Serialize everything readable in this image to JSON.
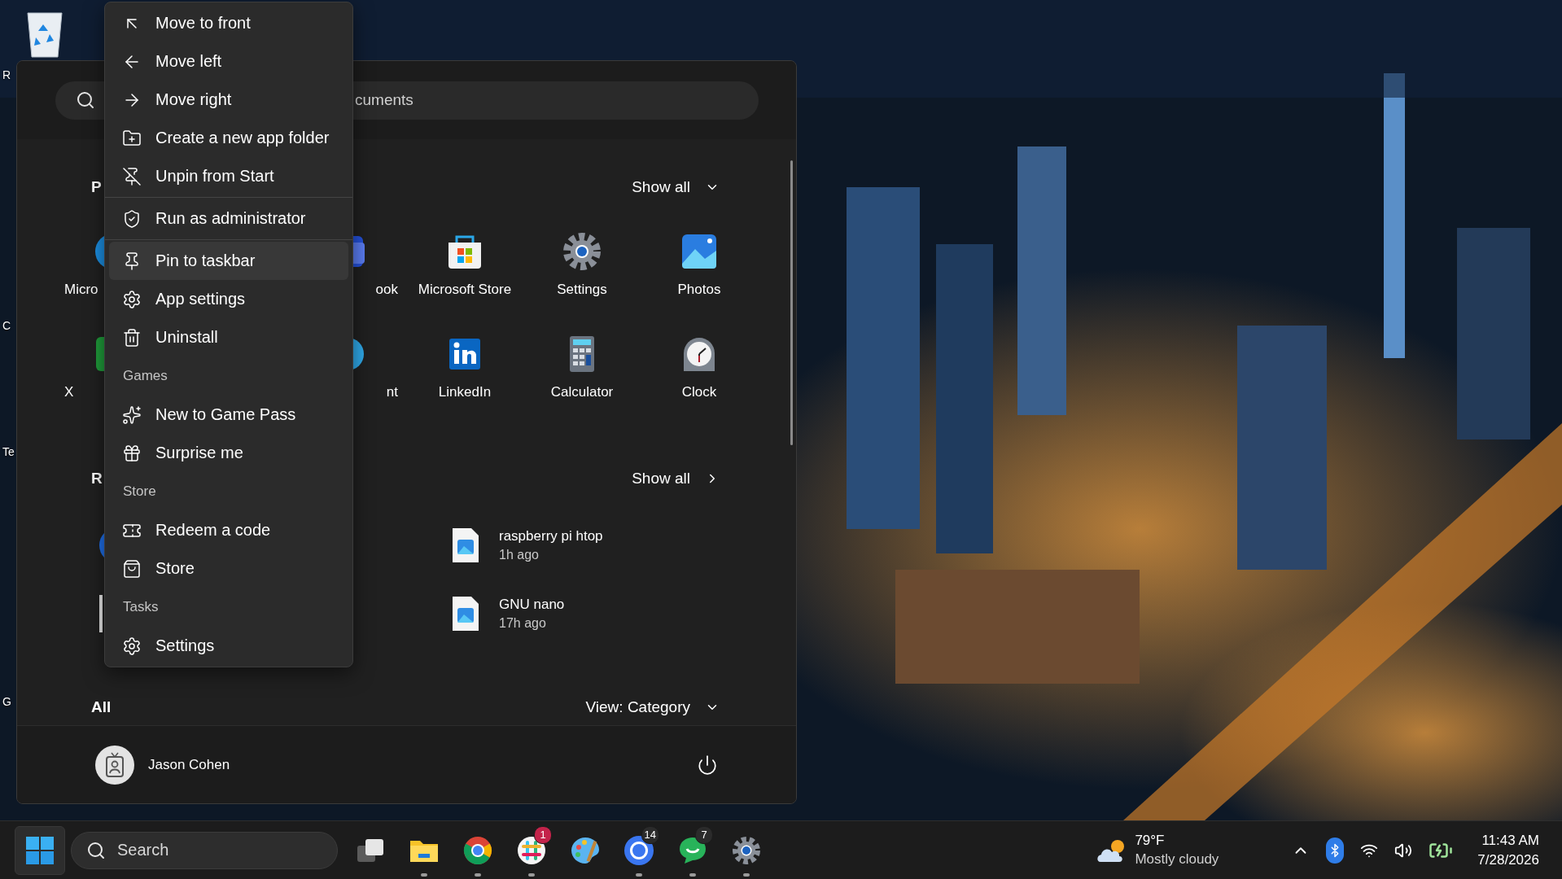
{
  "desktop_icons": [
    {
      "label": "R"
    },
    {
      "label": "C"
    },
    {
      "label": "Te"
    },
    {
      "label": "G"
    }
  ],
  "start_menu": {
    "search": {
      "placeholder": "cuments"
    },
    "pinned": {
      "title": "P",
      "show_all": "Show all",
      "apps": [
        {
          "label": "Micro"
        },
        {
          "label": "ook"
        },
        {
          "label": "Microsoft Store"
        },
        {
          "label": "Settings"
        },
        {
          "label": "Photos"
        },
        {
          "label": "X"
        },
        {
          "label": "nt"
        },
        {
          "label": "LinkedIn"
        },
        {
          "label": "Calculator"
        },
        {
          "label": "Clock"
        }
      ]
    },
    "recommended": {
      "title": "R",
      "show_all": "Show all",
      "items": [
        {
          "name": "raspberry pi htop",
          "time": "1h ago"
        },
        {
          "name": "GNU nano",
          "time": "17h ago"
        }
      ]
    },
    "all": {
      "title": "All",
      "view": "View: Category"
    },
    "user": {
      "name": "Jason Cohen"
    }
  },
  "context_menu": {
    "items": [
      {
        "kind": "item",
        "label": "Move to front",
        "selected": false
      },
      {
        "kind": "item",
        "label": "Move left",
        "selected": false
      },
      {
        "kind": "item",
        "label": "Move right",
        "selected": false
      },
      {
        "kind": "item",
        "label": "Create a new app folder",
        "selected": false
      },
      {
        "kind": "item",
        "label": "Unpin from Start",
        "selected": false
      },
      {
        "kind": "separator"
      },
      {
        "kind": "item",
        "label": "Run as administrator",
        "selected": false
      },
      {
        "kind": "separator"
      },
      {
        "kind": "item",
        "label": "Pin to taskbar",
        "selected": true
      },
      {
        "kind": "item",
        "label": "App settings",
        "selected": false
      },
      {
        "kind": "item",
        "label": "Uninstall",
        "selected": false
      },
      {
        "kind": "header",
        "label": "Games"
      },
      {
        "kind": "item",
        "label": "New to Game Pass",
        "selected": false
      },
      {
        "kind": "item",
        "label": "Surprise me",
        "selected": false
      },
      {
        "kind": "header",
        "label": "Store"
      },
      {
        "kind": "item",
        "label": "Redeem a code",
        "selected": false
      },
      {
        "kind": "item",
        "label": "Store",
        "selected": false
      },
      {
        "kind": "header",
        "label": "Tasks"
      },
      {
        "kind": "item",
        "label": "Settings",
        "selected": false
      }
    ]
  },
  "taskbar": {
    "search": {
      "placeholder": "Search"
    },
    "apps": [
      {
        "running": false
      },
      {
        "running": true
      },
      {
        "running": true
      },
      {
        "running": true,
        "badge": "1"
      },
      {
        "running": false
      },
      {
        "running": true,
        "badge": "14"
      },
      {
        "running": true,
        "badge": "7"
      },
      {
        "running": true
      }
    ],
    "weather": {
      "temperature": "79°F",
      "condition": "Mostly cloudy"
    },
    "clock": {
      "time": "11:43 AM",
      "date": "7/28/2026"
    }
  }
}
